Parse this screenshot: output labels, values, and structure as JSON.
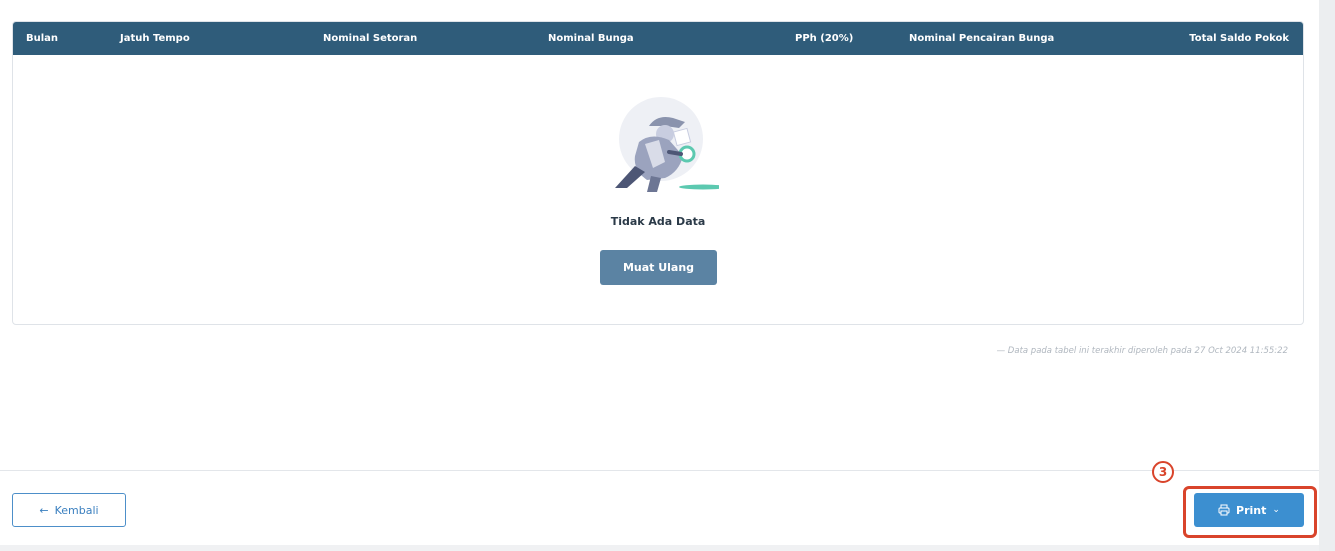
{
  "table": {
    "columns": [
      "Bulan",
      "Jatuh Tempo",
      "Nominal Setoran",
      "Nominal Bunga",
      "PPh (20%)",
      "Nominal Pencairan Bunga",
      "Total Saldo Pokok"
    ],
    "rows": [],
    "header_color": "#2f5c7a"
  },
  "empty_state": {
    "icon": "detective-magnifier-illustration",
    "message": "Tidak Ada Data",
    "reload_label": "Muat Ulang"
  },
  "timestamp_note": "— Data pada tabel ini terakhir diperoleh pada 27 Oct 2024 11:55:22",
  "footer": {
    "back_label": "Kembali",
    "back_icon": "arrow-left-icon",
    "print_label": "Print",
    "print_icon": "printer-icon",
    "print_dropdown_icon": "chevron-down-icon",
    "step_badge": "3",
    "highlight_color": "#d9442b",
    "primary_color": "#3c8fd0"
  }
}
